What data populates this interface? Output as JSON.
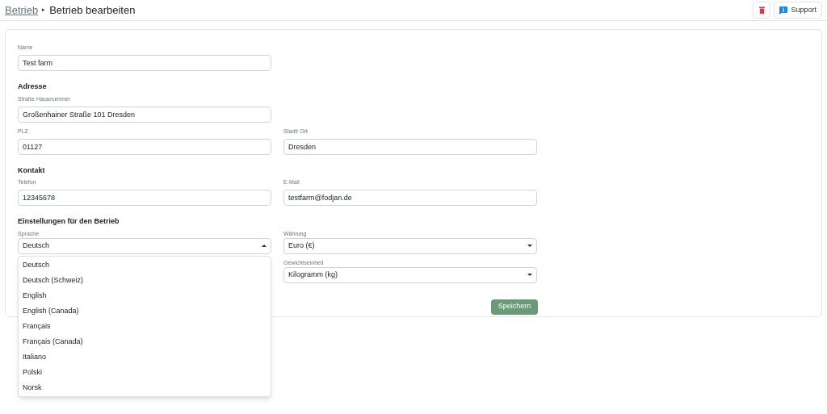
{
  "breadcrumb": {
    "parent": "Betrieb",
    "separator": "▸",
    "current": "Betrieb bearbeiten"
  },
  "toolbar": {
    "support": "Support"
  },
  "form": {
    "rows": [
      {
        "heading": "",
        "fields": [
          {
            "label": "Name",
            "value": "Test farm",
            "kind": "text"
          }
        ]
      },
      {
        "heading": "Adresse",
        "fields": [
          {
            "label": "Straße Hausnummer",
            "value": "Großenhainer Straße 101 Dresden",
            "kind": "text"
          }
        ]
      },
      {
        "heading": "",
        "fields": [
          {
            "label": "PLZ",
            "value": "01127",
            "kind": "text"
          },
          {
            "label": "Stadt/ Ort",
            "value": "Dresden",
            "kind": "text"
          }
        ]
      },
      {
        "heading": "Kontakt",
        "fields": [
          {
            "label": "Telefon",
            "value": "12345678",
            "kind": "text"
          },
          {
            "label": "E-Mail",
            "value": "testfarm@fodjan.de",
            "kind": "text"
          }
        ]
      },
      {
        "heading": "Einstellungen für den Betrieb",
        "fields": [
          {
            "label": "Sprache",
            "value": "Deutsch",
            "kind": "select",
            "expanded": true,
            "options": [
              "Deutsch",
              "Deutsch (Schweiz)",
              "English",
              "English (Canada)",
              "Français",
              "Français (Canada)",
              "Italiano",
              "Polski",
              "Norsk"
            ]
          },
          {
            "label": "Währung",
            "value": "Euro (€)",
            "kind": "select",
            "expanded": false
          }
        ]
      },
      {
        "heading": "",
        "fields": [
          {
            "kind": "empty"
          },
          {
            "label": "Gewichtseinheit",
            "value": "Kilogramm (kg)",
            "kind": "select",
            "expanded": false
          }
        ]
      }
    ],
    "save": "Speichern"
  }
}
